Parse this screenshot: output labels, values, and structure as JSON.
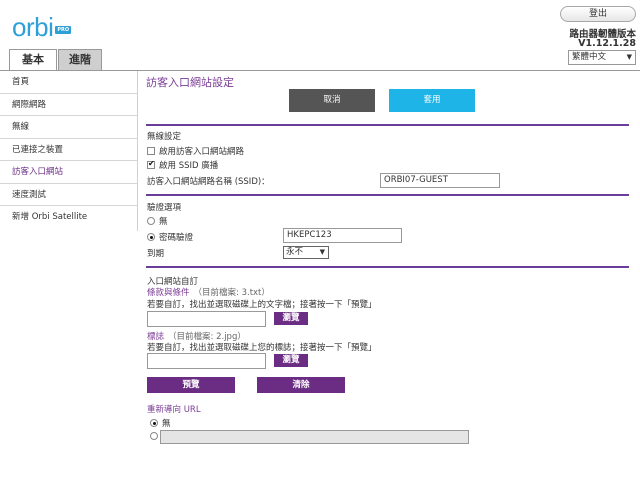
{
  "header": {
    "logo_text": "orbi",
    "logo_badge": "PRO",
    "logout_label": "登出",
    "firmware_label": "路由器韌體版本",
    "firmware_version": "V1.12.1.28",
    "language": "繁體中文"
  },
  "tabs": [
    {
      "label": "基本",
      "active": true
    },
    {
      "label": "進階",
      "active": false
    }
  ],
  "sidebar": {
    "items": [
      {
        "label": "首頁"
      },
      {
        "label": "網際網路"
      },
      {
        "label": "無線"
      },
      {
        "label": "已連接之裝置"
      },
      {
        "label": "訪客入口網站",
        "active": true
      },
      {
        "label": "速度測試"
      },
      {
        "label": "新增 Orbi Satellite"
      }
    ]
  },
  "main": {
    "title": "訪客入口網站設定",
    "cancel_label": "取消",
    "apply_label": "套用",
    "wireless": {
      "heading": "無線設定",
      "enable_portal_label": "啟用訪客入口網站網路",
      "enable_portal_checked": false,
      "ssid_broadcast_label": "啟用 SSID 廣播",
      "ssid_broadcast_checked": true,
      "ssid_label": "訪客入口網站網路名稱 (SSID)：",
      "ssid_value": "ORBI07-GUEST"
    },
    "auth": {
      "heading": "驗證選項",
      "none_label": "無",
      "password_label": "密碼驗證",
      "password_value": "HKEPC123",
      "expire_label": "到期",
      "expire_value": "永不"
    },
    "custom": {
      "heading": "入口網站自訂",
      "terms_label": "條款與條件",
      "terms_file": "（目前檔案: 3.txt）",
      "terms_hint": "若要自訂，找出並選取磁碟上的文字檔；接著按一下「預覽」",
      "browse_label": "瀏覽",
      "logo_label": "標誌",
      "logo_file": "（目前檔案: 2.jpg）",
      "logo_hint": "若要自訂，找出並選取磁碟上您的標誌；接著按一下「預覽」",
      "preview_label": "預覽",
      "clear_label": "清除"
    },
    "redirect": {
      "heading": "重新導向 URL",
      "none_label": "無"
    }
  },
  "colors": {
    "accent_purple": "#6b2c84",
    "accent_blue": "#1fb4e8",
    "logo_blue": "#2f9fd8"
  }
}
